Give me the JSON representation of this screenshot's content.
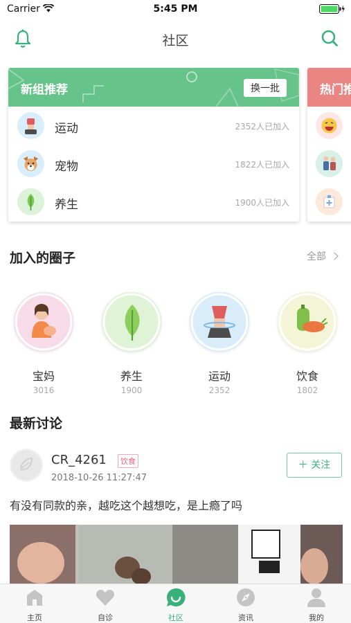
{
  "status_bar": {
    "carrier": "Carrier",
    "time": "5:45 PM"
  },
  "nav": {
    "title": "社区"
  },
  "recommend": {
    "title": "新组推荐",
    "change_label": "换一批",
    "groups": [
      {
        "name": "运动",
        "count": "2352人已加入",
        "icon": "exercise-icon"
      },
      {
        "name": "宠物",
        "count": "1822人已加入",
        "icon": "dog-icon"
      },
      {
        "name": "养生",
        "count": "1900人已加入",
        "icon": "leaf-icon"
      }
    ]
  },
  "hot": {
    "title": "热门推"
  },
  "joined": {
    "title": "加入的圈子",
    "see_all": "全部",
    "circles": [
      {
        "name": "宝妈",
        "count": "3016",
        "icon": "mother-icon"
      },
      {
        "name": "养生",
        "count": "1900",
        "icon": "leaf-icon"
      },
      {
        "name": "运动",
        "count": "2352",
        "icon": "exercise-icon"
      },
      {
        "name": "饮食",
        "count": "1802",
        "icon": "vegetable-icon"
      }
    ]
  },
  "discussion": {
    "title": "最新讨论",
    "post": {
      "user": "CR_4261",
      "tag": "饮食",
      "time": "2018-10-26 11:27:47",
      "follow": "＋ 关注",
      "text": "有没有同款的亲，越吃这个越想吃，是上瘾了吗"
    }
  },
  "tabs": [
    {
      "label": "主页",
      "icon": "home-icon"
    },
    {
      "label": "自诊",
      "icon": "heart-icon"
    },
    {
      "label": "社区",
      "icon": "community-icon",
      "active": true
    },
    {
      "label": "资讯",
      "icon": "compass-icon"
    },
    {
      "label": "我的",
      "icon": "person-icon"
    }
  ],
  "colors": {
    "accent": "#3ab07c",
    "recommend_header": "#66c389",
    "hot_header": "#e98683"
  }
}
